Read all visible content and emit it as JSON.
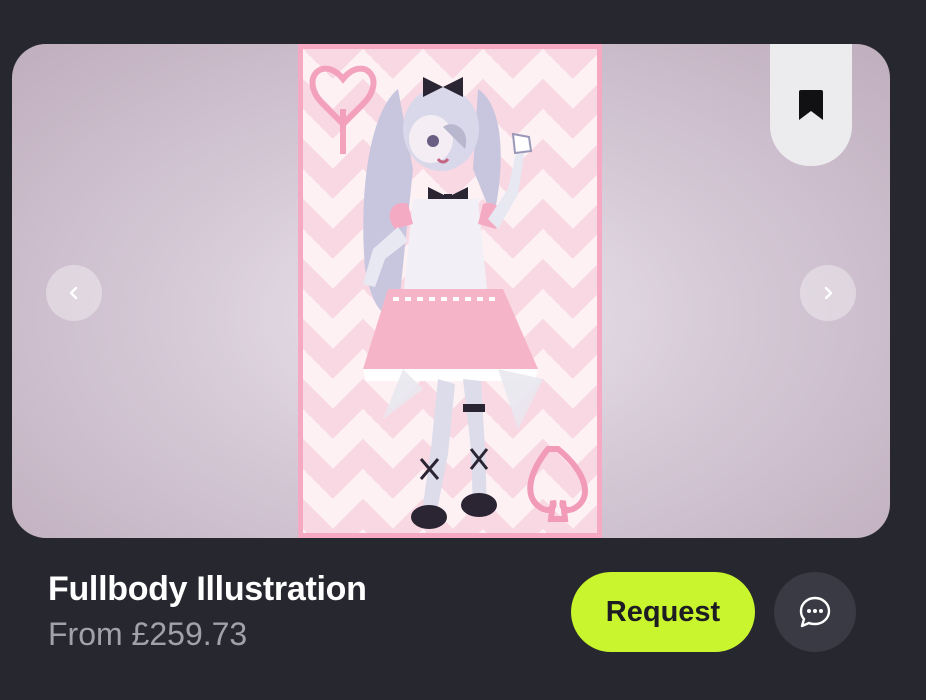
{
  "listing": {
    "title": "Fullbody Illustration",
    "price": "From £259.73"
  },
  "actions": {
    "request_label": "Request"
  },
  "icons": {
    "bookmark": "bookmark-icon",
    "prev": "chevron-left-icon",
    "next": "chevron-right-icon",
    "chat": "chat-bubble-icon"
  },
  "colors": {
    "background": "#27272f",
    "request_button": "#c8f52e",
    "price_text": "#a2a1a9",
    "artwork_border": "#f6a9c3"
  }
}
